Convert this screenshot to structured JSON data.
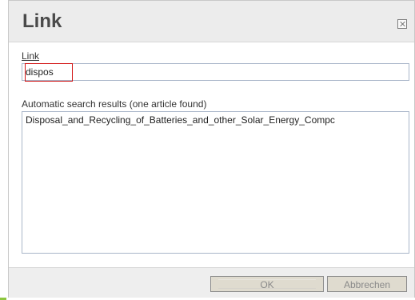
{
  "dialog": {
    "title": "Link",
    "close_label": "×"
  },
  "form": {
    "link_label": "Link",
    "link_value": "dispos",
    "results_label": "Automatic search results (one article found)",
    "results": [
      "Disposal_and_Recycling_of_Batteries_and_other_Solar_Energy_Compc"
    ]
  },
  "buttons": {
    "ok_label": "OK",
    "cancel_label": "Abbrechen"
  },
  "colors": {
    "highlight": "#d21515",
    "accent": "#8dc63f"
  }
}
